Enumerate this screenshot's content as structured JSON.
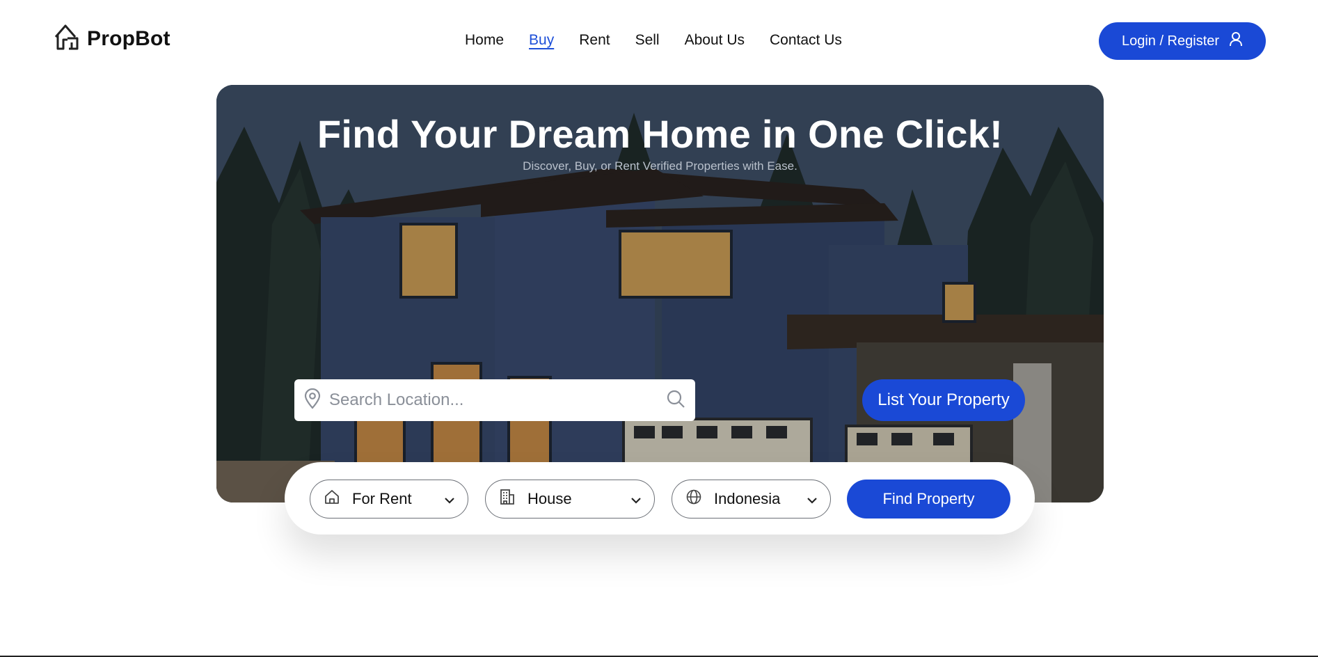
{
  "brand": {
    "name": "PropBot",
    "accent": "#1a49d6"
  },
  "nav": {
    "items": [
      {
        "label": "Home"
      },
      {
        "label": "Buy"
      },
      {
        "label": "Rent"
      },
      {
        "label": "Sell"
      },
      {
        "label": "About Us"
      },
      {
        "label": "Contact Us"
      }
    ],
    "active": "Buy"
  },
  "header": {
    "login_label": "Login / Register"
  },
  "hero": {
    "title": "Find Your Dream Home in One Click!",
    "subtitle": "Discover, Buy, or Rent Verified Properties with Ease.",
    "search_placeholder": "Search Location...",
    "list_button": "List Your Property"
  },
  "filters": {
    "listing_type": "For Rent",
    "property_type": "House",
    "country": "Indonesia",
    "find_button": "Find Property"
  },
  "icons": {
    "logo": "house-logo-icon",
    "user": "user-icon",
    "location": "map-pin-icon",
    "search": "search-icon",
    "home": "home-icon",
    "building": "building-icon",
    "globe": "globe-icon",
    "chevron": "chevron-down-icon"
  }
}
